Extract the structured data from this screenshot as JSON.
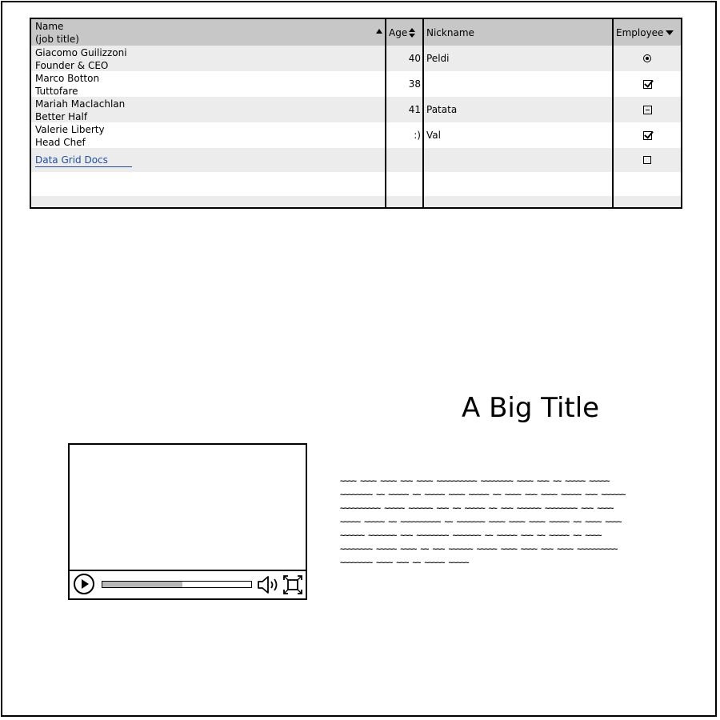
{
  "grid": {
    "columns": {
      "name_line1": "Name",
      "name_line2": "(job title)",
      "age": "Age",
      "nickname": "Nickname",
      "employee": "Employee"
    },
    "rows": [
      {
        "name": "Giacomo Guilizzoni",
        "title": "Founder & CEO",
        "age": "40",
        "nickname": "Peldi",
        "employee": "radio-selected"
      },
      {
        "name": "Marco Botton",
        "title": "Tuttofare",
        "age": "38",
        "nickname": "",
        "employee": "checked"
      },
      {
        "name": "Mariah Maclachlan",
        "title": "Better Half",
        "age": "41",
        "nickname": "Patata",
        "employee": "indeterminate"
      },
      {
        "name": "Valerie Liberty",
        "title": "Head Chef",
        "age": ":)",
        "nickname": "Val",
        "employee": "checked"
      }
    ],
    "link_row": {
      "link_text": "Data Grid Docs",
      "employee": "unchecked"
    }
  },
  "title": {
    "text": "A Big Title"
  },
  "video": {
    "progress": 0.54,
    "icons": {
      "play": "play-icon",
      "volume": "volume-icon",
      "fullscreen": "fullscreen-icon"
    }
  },
  "paragraph": {
    "text": "~~~~ ~~~~ ~~~~ ~~~ ~~~~ ~~~~~~~~~~ ~~~~~~~~ ~~~~ ~~~ ~~ ~~~~~ ~~~~~ ~~~~~~~~ ~~ ~~~~~ ~~ ~~~~~ ~~~~ ~~~~~ ~~ ~~~~ ~~~ ~~~~ ~~~~~ ~~~ ~~~~~~ ~~~~~~~~~~ ~~~~~ ~~~~~~ ~~~ ~~ ~~~~~ ~~ ~~~ ~~~~~~ ~~~~~~~~ ~~~ ~~~~ ~~~~~ ~~~~~ ~~ ~~~~~~~~~~ ~~ ~~~~~~~ ~~~~ ~~~~ ~~~~ ~~~~~ ~~ ~~~~ ~~~~ ~~~~~~ ~~~~~~~ ~~~ ~~~~~~~~ ~~~~~~~ ~~ ~~~~~ ~~~ ~~ ~~~~~ ~~ ~~~~ ~~~~~~~~ ~~~~~ ~~~~ ~~ ~~~ ~~~~~~ ~~~~~ ~~~~ ~~~~ ~~~ ~~~~ ~~~~~~~~~~ ~~~~~~~~ ~~~~ ~~~ ~~ ~~~~~ ~~~~~"
  },
  "colors": {
    "header_bg": "#c7c7c7",
    "row_alt_bg": "#ececec",
    "link": "#1f4fa0",
    "progress_fill": "#b8b8b8"
  }
}
